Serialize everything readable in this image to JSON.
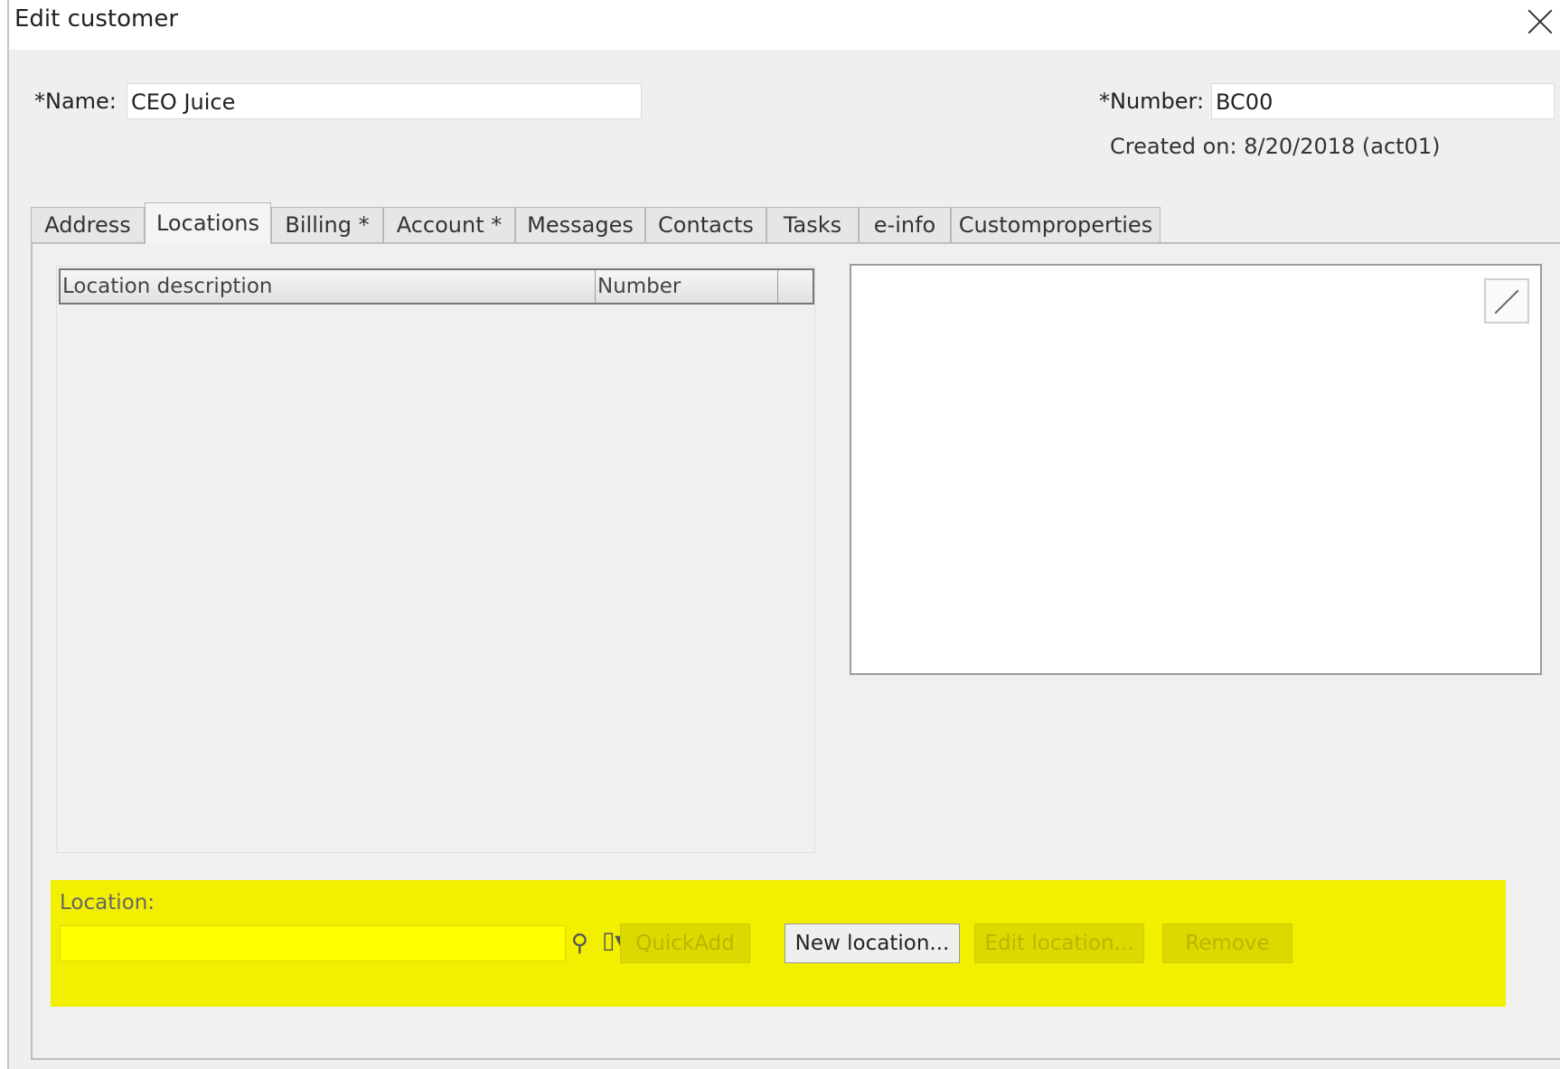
{
  "dialog": {
    "title": "Edit customer",
    "close_label": "×"
  },
  "fields": {
    "name_label": "*Name:",
    "name_value": "CEO Juice",
    "number_label": "*Number:",
    "number_value": "BC00",
    "created_on": "Created on: 8/20/2018 (act01)"
  },
  "tabs": [
    {
      "label": "Address"
    },
    {
      "label": "Locations"
    },
    {
      "label": "Billing  *"
    },
    {
      "label": "Account *"
    },
    {
      "label": "Messages"
    },
    {
      "label": "Contacts"
    },
    {
      "label": "Tasks"
    },
    {
      "label": "e-info"
    },
    {
      "label": "Customproperties"
    }
  ],
  "active_tab": "Locations",
  "locations_list": {
    "columns": [
      "Location description",
      "Number",
      ""
    ],
    "rows": []
  },
  "location_bar": {
    "label": "Location:",
    "value": "",
    "search_icon": "search-icon",
    "dropdown_icon": "menu-dropdown-icon",
    "quickadd": "QuickAdd",
    "new_location": "New location...",
    "edit_location": "Edit location...",
    "remove": "Remove",
    "highlight_color": "#f2ef00"
  }
}
